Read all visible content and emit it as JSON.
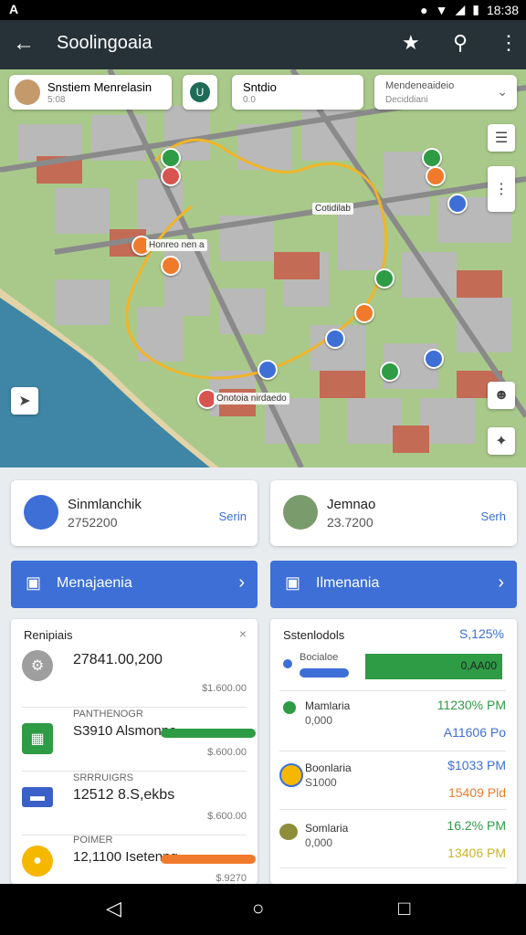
{
  "status": {
    "left_icon": "A",
    "time": "18:38"
  },
  "app": {
    "title": "Soolingoaia"
  },
  "map": {
    "card1": {
      "title": "Snstiem Menrelasin",
      "sub": "5:08"
    },
    "card2": {
      "title": "Sntdio",
      "sub": "0.0"
    },
    "card3": {
      "title": "Mendeneaideio",
      "sub": "Deciddiani"
    },
    "labels": [
      "Honreo nen a",
      "Cotidilab",
      "Onotoia nirdaedo"
    ]
  },
  "profiles": [
    {
      "name": "Sinmlanchik",
      "number": "2752200",
      "link": "Serin"
    },
    {
      "name": "Jemnao",
      "number": "23.7200",
      "link": "Serh"
    }
  ],
  "buttons": [
    {
      "label": "Menajaenia"
    },
    {
      "label": "Ilmenania"
    }
  ],
  "left_panel": {
    "title": "Renipiais",
    "rows": [
      {
        "label": "",
        "value": "27841.00,200",
        "sub": "$1.600.00",
        "bar": null,
        "color": "#9e9e9e",
        "icon": "gear-icon"
      },
      {
        "label": "PANTHENOGR",
        "value": "S3910 Alsmonne",
        "sub": "$.600.00",
        "bar": 0.9,
        "barcolor": "#2e9b45",
        "color": "#2e9b45",
        "icon": "building-icon"
      },
      {
        "label": "SRRRUIGRS",
        "value": "12512 8.S,ekbs",
        "sub": "$.600.00",
        "bar": null,
        "color": "#3a5fc7",
        "icon": "card-icon"
      },
      {
        "label": "POIMER",
        "value": "12,1100 Isetenng",
        "sub": "$.9270",
        "bar": 0.75,
        "barcolor": "#f07a2c",
        "color": "#f5b700",
        "icon": "coin-icon"
      }
    ]
  },
  "right_panel": {
    "title": "Sstenlodols",
    "title_value": "S,125%",
    "rows": [
      {
        "label": "Bocialoe",
        "sub": "",
        "v1": "0,AA00",
        "v2": "",
        "color": "#3d6fd6"
      },
      {
        "label": "Mamlaria",
        "sub": "0,000",
        "v1": "11230% PM",
        "v2": "A11606 Po",
        "color": "#2e9b45"
      },
      {
        "label": "Boonlaria",
        "sub": "S1000",
        "v1": "$1033 PM",
        "v2": "15409 Pld",
        "color": "#f5b700"
      },
      {
        "label": "Somlaria",
        "sub": "0,000",
        "v1": "16.2% PM",
        "v2": "13406 PM",
        "color": "#8d8d3a"
      }
    ]
  },
  "nav": {
    "back": "◁",
    "home": "○",
    "recent": "□"
  },
  "colors": {
    "primary": "#3d6fd6",
    "appbar": "#263238",
    "green": "#2e9b45",
    "orange": "#f07a2c"
  }
}
